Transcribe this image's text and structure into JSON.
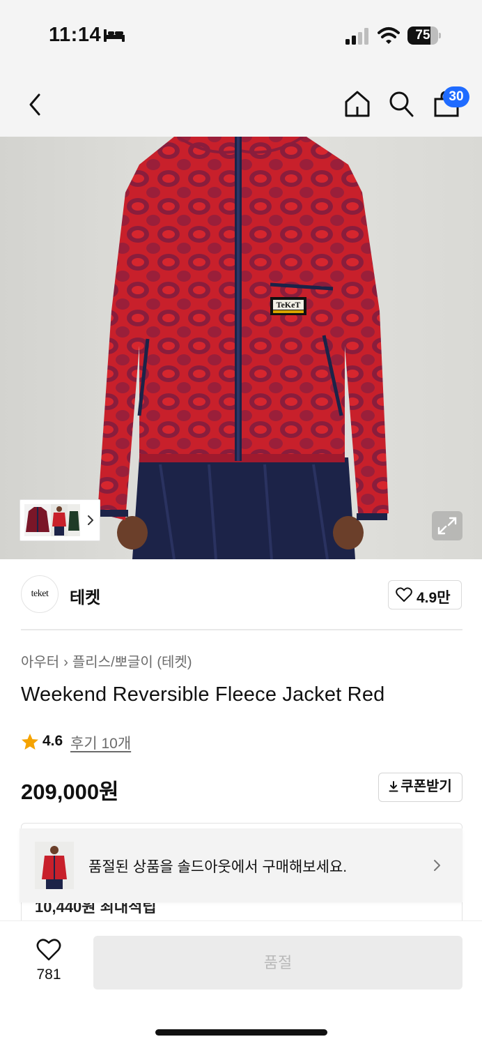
{
  "status_bar": {
    "time": "11:14",
    "battery": "75",
    "battery_level_percent": 75
  },
  "nav": {
    "cart_count": "30"
  },
  "brand": {
    "logo_text": "teket",
    "name": "테켓",
    "like_count": "4.9만"
  },
  "product": {
    "category_main": "아우터",
    "category_sub": "플리스/뽀글이 (테켓)",
    "title": "Weekend Reversible Fleece Jacket Red",
    "rating": "4.6",
    "review_link": "후기 10개",
    "price": "209,000원",
    "coupon_label": "쿠폰받기"
  },
  "benefit": {
    "peek_text": "10,440원 최대적립"
  },
  "soldout_banner": {
    "text": "품절된 상품을 솔드아웃에서 구매해보세요."
  },
  "bottom_bar": {
    "like_count": "781",
    "button_label": "품절"
  },
  "colors": {
    "accent_blue": "#1f6bff",
    "star": "#f5a300",
    "jacket_red": "#c8202b",
    "jacket_navy": "#1c2348"
  },
  "icons": [
    "bed-icon",
    "signal-icon",
    "wifi-icon",
    "back-icon",
    "home-icon",
    "search-icon",
    "bag-icon",
    "expand-icon",
    "heart-icon",
    "star-icon",
    "download-icon",
    "chevron-right-icon"
  ]
}
